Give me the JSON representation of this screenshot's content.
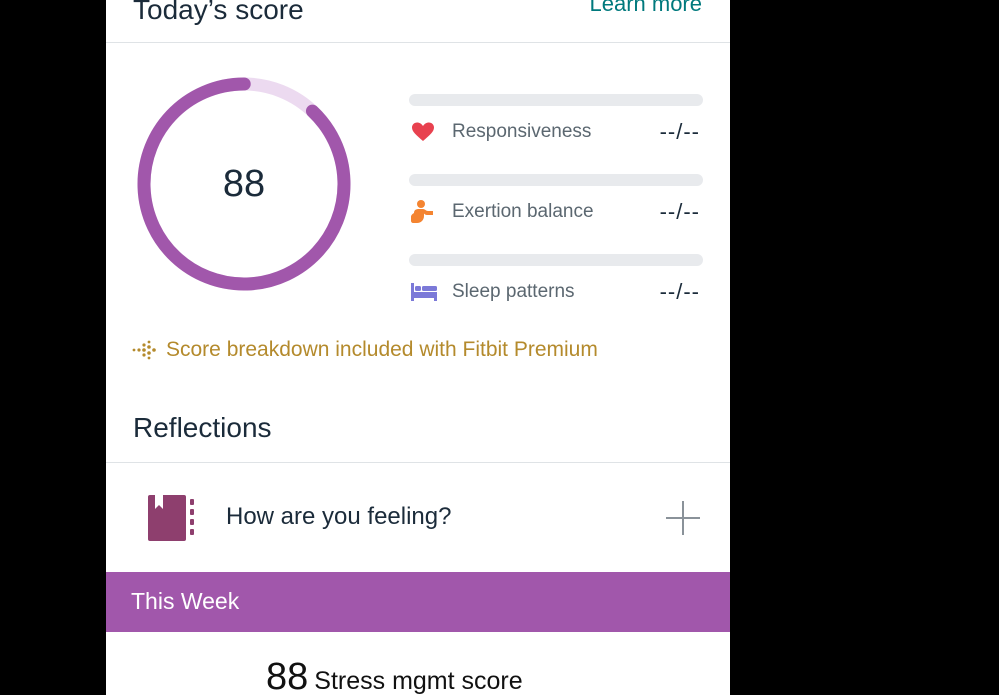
{
  "header": {
    "title": "Today’s score",
    "link": "Learn more"
  },
  "score": {
    "value": "88",
    "ring_progress": 0.88,
    "ring_color": "#a157ab",
    "ring_track_color": "#ecdaf0"
  },
  "metrics": [
    {
      "label": "Responsiveness",
      "value": "--/--",
      "icon": "heart-icon",
      "icon_color": "#e8414f"
    },
    {
      "label": "Exertion balance",
      "value": "--/--",
      "icon": "person-exercising-icon",
      "icon_color": "#f48431"
    },
    {
      "label": "Sleep patterns",
      "value": "--/--",
      "icon": "bed-icon",
      "icon_color": "#7b79d8"
    }
  ],
  "premium": {
    "text": "Score breakdown included with Fitbit Premium",
    "icon": "premium-dots-icon",
    "color": "#b48a2c"
  },
  "reflections": {
    "title": "Reflections",
    "prompt": "How are you feeling?",
    "icon": "journal-icon",
    "icon_color": "#8e3f6e",
    "action_icon": "plus-icon"
  },
  "week": {
    "title": "This Week",
    "bg_color": "#a157ab"
  },
  "weekly_score": {
    "value": "88",
    "label": "Stress mgmt score"
  }
}
